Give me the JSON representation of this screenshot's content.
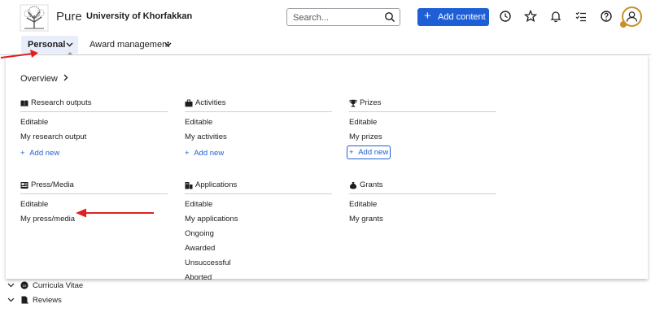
{
  "header": {
    "brand": "Pure",
    "organization": "University of Khorfakkan",
    "search_placeholder": "Search...",
    "add_content_label": "Add content",
    "icons": [
      "history-icon",
      "star-icon",
      "bell-icon",
      "tasks-icon",
      "help-icon",
      "user-icon"
    ]
  },
  "nav": {
    "tabs": [
      {
        "label": "Personal",
        "active": true
      },
      {
        "label": "Award management",
        "active": false
      }
    ]
  },
  "menu": {
    "overview_label": "Overview",
    "sections": [
      {
        "title": "Research outputs",
        "items": [
          "Editable",
          "My research output"
        ],
        "add_new": "Add new"
      },
      {
        "title": "Activities",
        "items": [
          "Editable",
          "My activities"
        ],
        "add_new": "Add new"
      },
      {
        "title": "Prizes",
        "items": [
          "Editable",
          "My prizes"
        ],
        "add_new": "Add new"
      },
      {
        "title": "Press/Media",
        "items": [
          "Editable",
          "My press/media"
        ]
      },
      {
        "title": "Applications",
        "items": [
          "Editable",
          "My applications",
          "Ongoing",
          "Awarded",
          "Unsuccessful",
          "Aborted"
        ]
      },
      {
        "title": "Grants",
        "items": [
          "Editable",
          "My grants"
        ]
      }
    ]
  },
  "below": {
    "items": [
      "Curricula Vitae",
      "Reviews"
    ]
  },
  "colors": {
    "accent": "#1e5fd6",
    "annotation_arrow": "#e02020",
    "avatar_ring": "#c9902a"
  }
}
